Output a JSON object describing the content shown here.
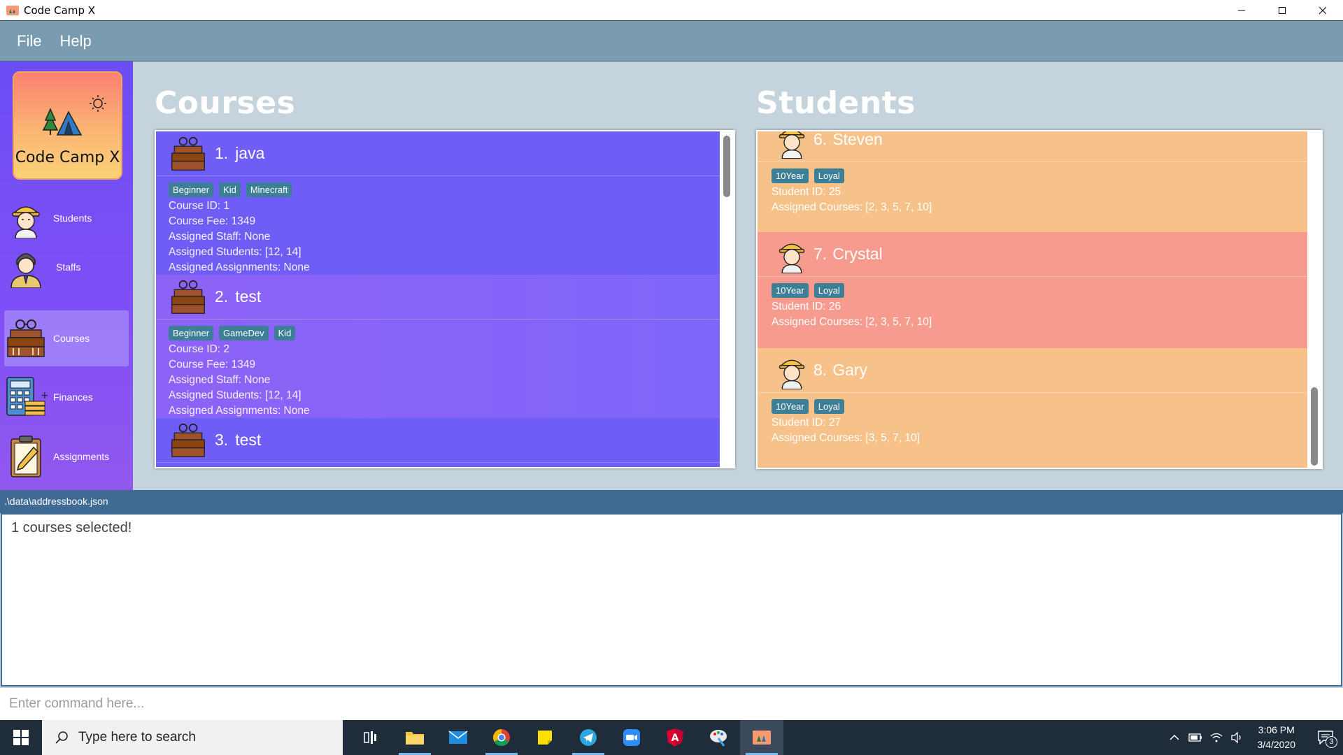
{
  "window": {
    "title": "Code Camp X",
    "controls": [
      "minimize",
      "maximize",
      "close"
    ]
  },
  "menu": {
    "items": [
      "File",
      "Help"
    ]
  },
  "sidebar": {
    "logo_text": "Code Camp X",
    "items": [
      {
        "label": "Students",
        "icon": "student-icon",
        "active": false
      },
      {
        "label": "Staffs",
        "icon": "staff-icon",
        "active": false
      },
      {
        "label": "Courses",
        "icon": "courses-icon",
        "active": true
      },
      {
        "label": "Finances",
        "icon": "finance-icon",
        "active": false
      },
      {
        "label": "Assignments",
        "icon": "assignment-icon",
        "active": false
      }
    ]
  },
  "courses": {
    "title": "Courses",
    "items": [
      {
        "index": "1.",
        "name": "java",
        "tags": [
          "Beginner",
          "Kid",
          "Minecraft"
        ],
        "course_id": "Course ID: 1",
        "fee": "Course Fee: 1349",
        "staff": "Assigned Staff: None",
        "students": "Assigned Students: [12, 14]",
        "assignments": "Assigned Assignments: None"
      },
      {
        "index": "2.",
        "name": "test",
        "tags": [
          "Beginner",
          "GameDev",
          "Kid"
        ],
        "course_id": "Course ID: 2",
        "fee": "Course Fee: 1349",
        "staff": "Assigned Staff: None",
        "students": "Assigned Students: [12, 14]",
        "assignments": "Assigned Assignments: None"
      },
      {
        "index": "3.",
        "name": "test"
      }
    ]
  },
  "students": {
    "title": "Students",
    "items": [
      {
        "index": "6.",
        "name": "Steven",
        "tags": [
          "10Year",
          "Loyal"
        ],
        "student_id": "Student ID: 25",
        "courses": "Assigned Courses: [2, 3, 5, 7, 10]",
        "bg": "#f6c28a"
      },
      {
        "index": "7.",
        "name": "Crystal",
        "tags": [
          "10Year",
          "Loyal"
        ],
        "student_id": "Student ID: 26",
        "courses": "Assigned Courses: [2, 3, 5, 7, 10]",
        "bg": "#f79b8e"
      },
      {
        "index": "8.",
        "name": "Gary",
        "tags": [
          "10Year",
          "Loyal"
        ],
        "student_id": "Student ID: 27",
        "courses": "Assigned Courses: [3, 5, 7, 10]",
        "bg": "#f6c28a"
      }
    ]
  },
  "status": {
    "file_path": ".\\data\\addressbook.json"
  },
  "result": {
    "text": "1 courses selected!"
  },
  "command": {
    "placeholder": "Enter command here..."
  },
  "taskbar": {
    "search_placeholder": "Type here to search",
    "apps": [
      "task-view-icon",
      "file-explorer-icon",
      "mail-icon",
      "chrome-icon",
      "sticky-notes-icon",
      "telegram-icon",
      "zoom-icon",
      "angular-icon",
      "paint-icon",
      "code-camp-icon"
    ],
    "time": "3:06 PM",
    "date": "3/4/2020",
    "notification_count": "3"
  },
  "colors": {
    "accent": "#7b9cb0",
    "sidebar": "#7e4ef6",
    "course_card": "#6f5ff7",
    "student_card": "#f6c28a",
    "tag": "#3c7f96",
    "status_bar": "#3f6a93"
  }
}
